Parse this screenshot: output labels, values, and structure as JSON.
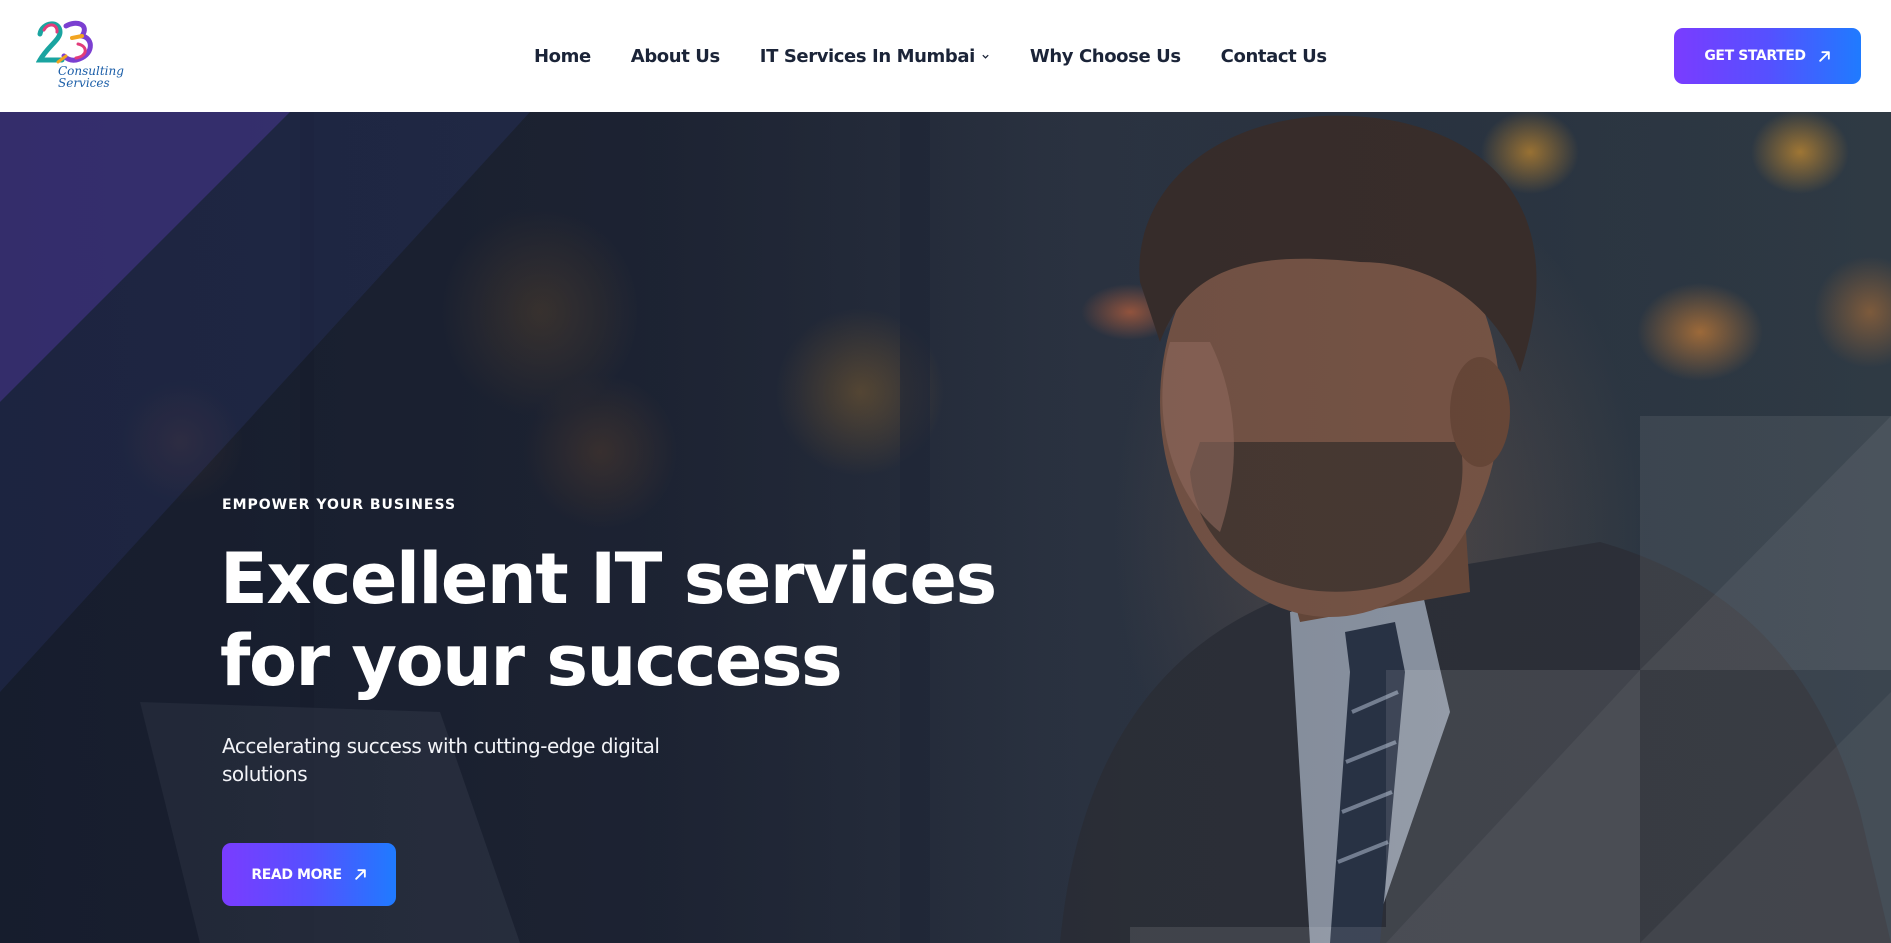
{
  "header": {
    "logo": {
      "numerals": "23",
      "line1": "Consulting",
      "line2": "Services"
    },
    "nav": [
      {
        "label": "Home"
      },
      {
        "label": "About Us"
      },
      {
        "label": "IT Services In Mumbai",
        "icon": "chevron-down-icon"
      },
      {
        "label": "Why Choose Us"
      },
      {
        "label": "Contact Us"
      }
    ],
    "cta_label": "GET STARTED",
    "cta_icon": "arrow-up-right-icon"
  },
  "hero": {
    "eyebrow": "EMPOWER YOUR BUSINESS",
    "headline_line1": "Excellent IT services",
    "headline_line2": "for your success",
    "subtext": "Accelerating success with cutting-edge digital solutions",
    "button_label": "READ MORE",
    "button_icon": "arrow-up-right-icon"
  },
  "colors": {
    "button_gradient_start": "#7a3cff",
    "button_gradient_end": "#1f7bff",
    "nav_text": "#1b2438",
    "hero_text": "#ffffff"
  }
}
